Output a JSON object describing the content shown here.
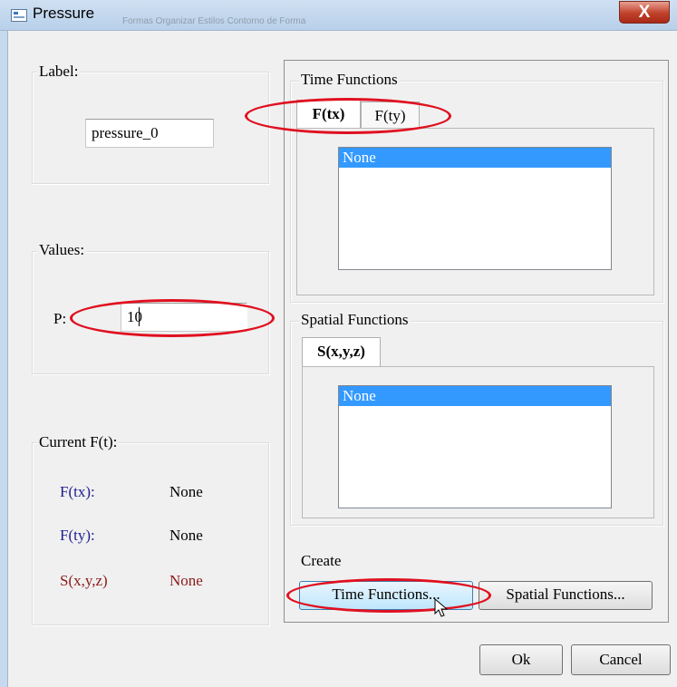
{
  "window": {
    "title": "Pressure",
    "close_glyph": "X",
    "background_strip": "Formas  Organizar  Estilos      Contorno de Forma"
  },
  "label_group": {
    "title": "Label:",
    "value": "pressure_0"
  },
  "values_group": {
    "title": "Values:",
    "p_label": "P:",
    "p_value": "10"
  },
  "current_group": {
    "title": "Current F(t):",
    "rows": [
      {
        "name": "F(tx):",
        "value": "None",
        "color": "#1f1f8f"
      },
      {
        "name": "F(ty):",
        "value": "None",
        "color": "#1f1f8f"
      },
      {
        "name": "S(x,y,z)",
        "value": "None",
        "color": "#8b1a1a"
      }
    ]
  },
  "time_functions": {
    "title": "Time Functions",
    "tabs": [
      {
        "label": "F(tx)",
        "active": true
      },
      {
        "label": "F(ty)",
        "active": false
      }
    ],
    "list": [
      "None"
    ]
  },
  "spatial_functions": {
    "title": "Spatial Functions",
    "tabs": [
      {
        "label": "S(x,y,z)",
        "active": true
      }
    ],
    "list": [
      "None"
    ]
  },
  "create_group": {
    "title": "Create",
    "time_button": "Time Functions...",
    "spatial_button": "Spatial Functions..."
  },
  "footer": {
    "ok": "Ok",
    "cancel": "Cancel"
  },
  "colors": {
    "highlight_ring": "#e01020",
    "selection": "#3399ff"
  }
}
